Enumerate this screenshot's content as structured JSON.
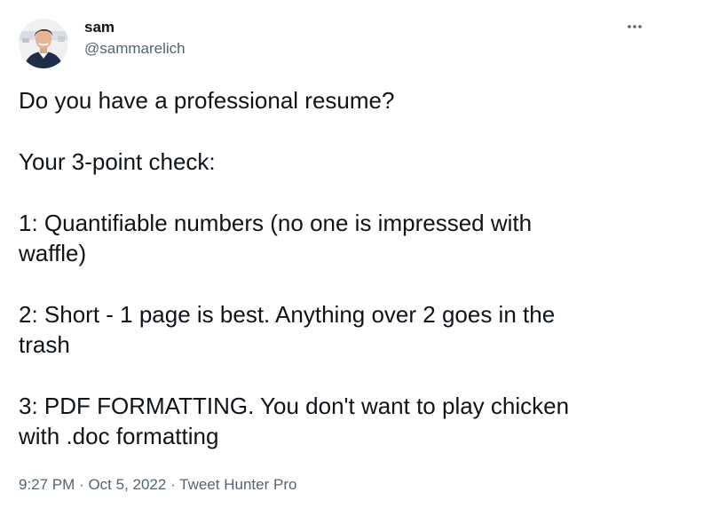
{
  "author": {
    "name": "sam",
    "handle": "@sammarelich",
    "avatar_icon": "profile-photo"
  },
  "more_icon": "more-horizontal-icon",
  "tweet": {
    "paragraphs": [
      "Do you have a professional resume?",
      "Your 3-point check:",
      "1: Quantifiable numbers (no one is impressed with\nwaffle)",
      "2: Short - 1 page is best. Anything over 2 goes in the\ntrash",
      "3: PDF FORMATTING. You don't want to play chicken\nwith .doc formatting"
    ]
  },
  "meta": {
    "time": "9:27 PM",
    "date": "Oct 5, 2022",
    "source": "Tweet Hunter Pro",
    "separator": "·"
  },
  "colors": {
    "text": "#0f1419",
    "secondary": "#536471"
  }
}
